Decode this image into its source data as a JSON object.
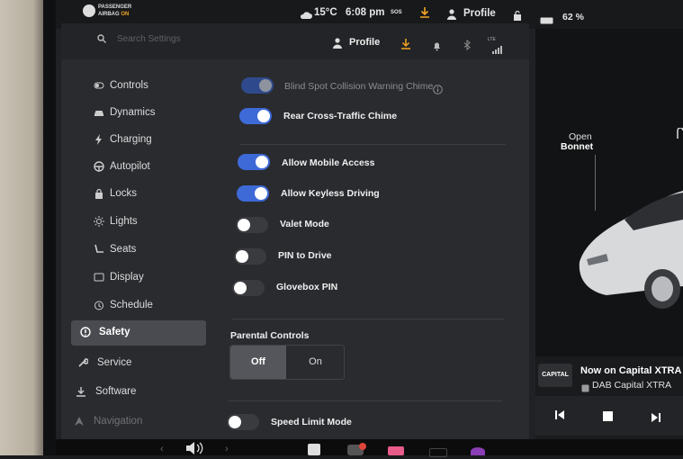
{
  "status_bar": {
    "airbag_line1": "PASSENGER",
    "airbag_line2": "AIRBAG",
    "airbag_state": "ON",
    "temperature": "15°C",
    "time": "6:08 pm",
    "sos": "SOS",
    "profile": "Profile",
    "battery": "62 %"
  },
  "settings_header": {
    "search_placeholder": "Search Settings",
    "profile": "Profile",
    "signal": "LTE"
  },
  "sidebar": {
    "items": [
      {
        "label": "Controls",
        "icon": "toggle-icon"
      },
      {
        "label": "Dynamics",
        "icon": "car-icon"
      },
      {
        "label": "Charging",
        "icon": "lightning-icon"
      },
      {
        "label": "Autopilot",
        "icon": "steering-wheel-icon"
      },
      {
        "label": "Locks",
        "icon": "lock-icon"
      },
      {
        "label": "Lights",
        "icon": "sun-icon"
      },
      {
        "label": "Seats",
        "icon": "seat-icon"
      },
      {
        "label": "Display",
        "icon": "display-icon"
      },
      {
        "label": "Schedule",
        "icon": "alarm-clock-icon"
      },
      {
        "label": "Safety",
        "icon": "alert-circle-icon"
      },
      {
        "label": "Service",
        "icon": "wrench-icon"
      },
      {
        "label": "Software",
        "icon": "download-icon"
      },
      {
        "label": "Navigation",
        "icon": "navigation-icon"
      }
    ],
    "active": "Safety"
  },
  "safety": {
    "blind_spot": "Blind Spot Collision Warning Chime",
    "rear_cross": "Rear Cross-Traffic Chime",
    "mobile_access": "Allow Mobile Access",
    "keyless": "Allow Keyless Driving",
    "valet": "Valet Mode",
    "pin_drive": "PIN to Drive",
    "glovebox": "Glovebox PIN",
    "parental_title": "Parental Controls",
    "parental_off": "Off",
    "parental_on": "On",
    "speed_limit": "Speed Limit Mode"
  },
  "car_view": {
    "open": "Open",
    "bonnet": "Bonnet"
  },
  "media": {
    "station_logo": "CAPITAL",
    "now_on": "Now on Capital XTRA",
    "source": "DAB Capital XTRA"
  },
  "colors": {
    "accent": "#3e6ad8",
    "warning": "#f5a623"
  }
}
